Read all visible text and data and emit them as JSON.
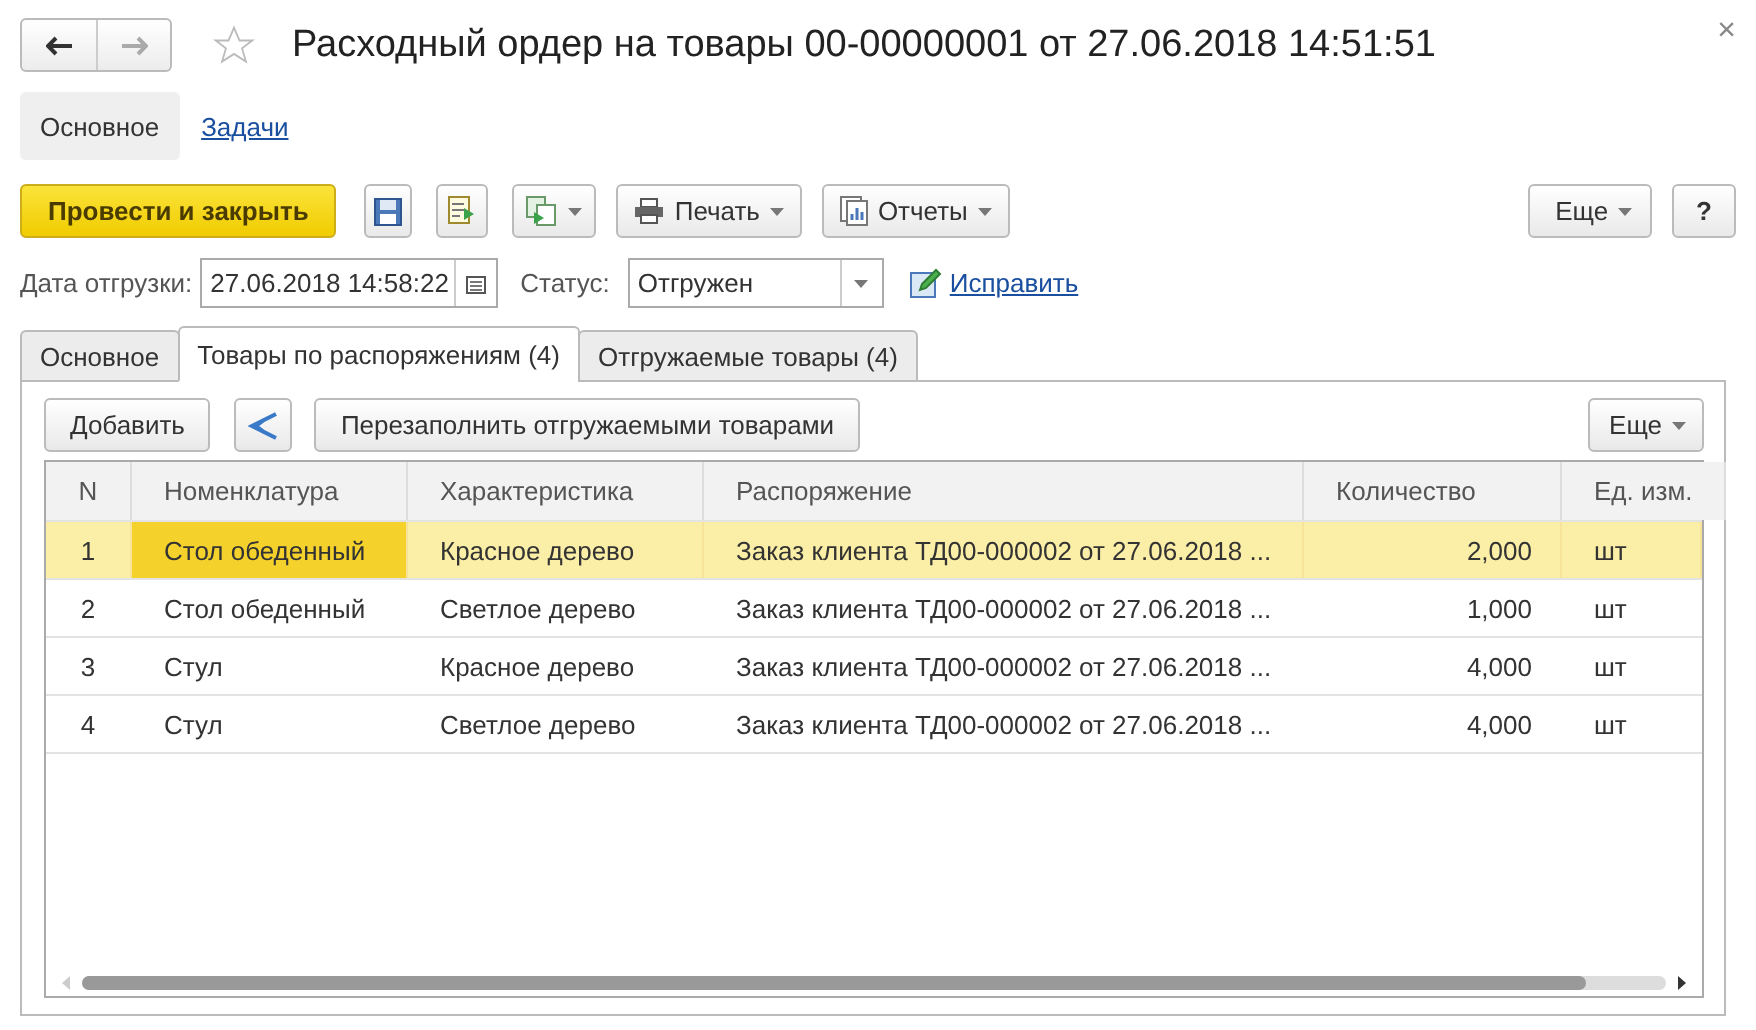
{
  "window": {
    "title": "Расходный ордер на товары 00-00000001 от 27.06.2018 14:51:51",
    "favorite": false,
    "close": "×"
  },
  "sections": [
    {
      "label": "Основное",
      "selected": true
    },
    {
      "label": "Задачи",
      "selected": false
    }
  ],
  "toolbar": {
    "primary": "Провести и закрыть",
    "print": "Печать",
    "reports": "Отчеты",
    "more": "Еще",
    "help": "?"
  },
  "fields": {
    "date_label": "Дата отгрузки:",
    "date_value": "27.06.2018 14:58:22",
    "status_label": "Статус:",
    "status_value": "Отгружен",
    "fix_link": "Исправить"
  },
  "tabs": [
    {
      "label": "Основное",
      "selected": false
    },
    {
      "label": "Товары по распоряжениям (4)",
      "selected": true
    },
    {
      "label": "Отгружаемые товары (4)",
      "selected": false
    }
  ],
  "table_toolbar": {
    "add": "Добавить",
    "refill": "Перезаполнить отгружаемыми товарами",
    "more": "Еще"
  },
  "table": {
    "columns": [
      {
        "label": "N",
        "kind": "index"
      },
      {
        "label": "Номенклатура",
        "kind": "text"
      },
      {
        "label": "Характеристика",
        "kind": "text"
      },
      {
        "label": "Распоряжение",
        "kind": "text"
      },
      {
        "label": "Количество",
        "kind": "number"
      },
      {
        "label": "Ед. изм.",
        "kind": "text"
      }
    ],
    "rows": [
      {
        "selected": true,
        "cells": [
          {
            "text": "1",
            "current": false
          },
          {
            "text": "Стол обеденный",
            "current": true
          },
          {
            "text": "Красное дерево",
            "current": false
          },
          {
            "text": "Заказ клиента ТД00-000002 от 27.06.2018 ...",
            "current": false
          },
          {
            "text": "2,000",
            "current": false
          },
          {
            "text": "шт",
            "current": false
          }
        ]
      },
      {
        "selected": false,
        "cells": [
          {
            "text": "2",
            "current": false
          },
          {
            "text": "Стол обеденный",
            "current": false
          },
          {
            "text": "Светлое дерево",
            "current": false
          },
          {
            "text": "Заказ клиента ТД00-000002 от 27.06.2018 ...",
            "current": false
          },
          {
            "text": "1,000",
            "current": false
          },
          {
            "text": "шт",
            "current": false
          }
        ]
      },
      {
        "selected": false,
        "cells": [
          {
            "text": "3",
            "current": false
          },
          {
            "text": "Стул",
            "current": false
          },
          {
            "text": "Красное дерево",
            "current": false
          },
          {
            "text": "Заказ клиента ТД00-000002 от 27.06.2018 ...",
            "current": false
          },
          {
            "text": "4,000",
            "current": false
          },
          {
            "text": "шт",
            "current": false
          }
        ]
      },
      {
        "selected": false,
        "cells": [
          {
            "text": "4",
            "current": false
          },
          {
            "text": "Стул",
            "current": false
          },
          {
            "text": "Светлое дерево",
            "current": false
          },
          {
            "text": "Заказ клиента ТД00-000002 от 27.06.2018 ...",
            "current": false
          },
          {
            "text": "4,000",
            "current": false
          },
          {
            "text": "шт",
            "current": false
          }
        ]
      }
    ]
  }
}
